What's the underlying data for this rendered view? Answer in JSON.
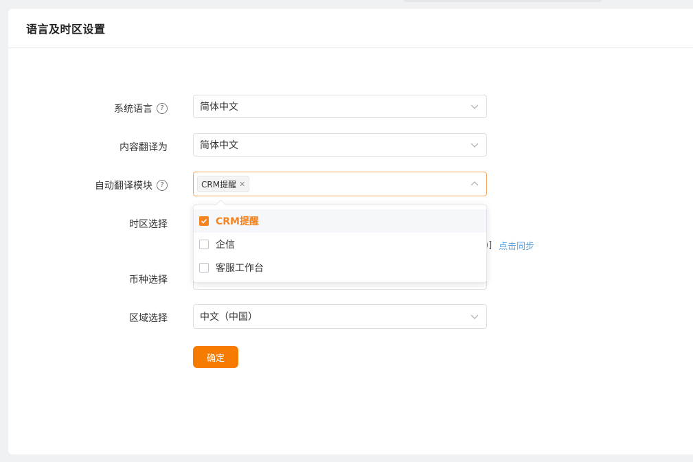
{
  "page": {
    "title": "语言及时区设置"
  },
  "form": {
    "system_language": {
      "label": "系统语言",
      "value": "简体中文"
    },
    "content_translate": {
      "label": "内容翻译为",
      "value": "简体中文"
    },
    "auto_translate_modules": {
      "label": "自动翻译模块",
      "selected_tags": [
        "CRM提醒"
      ],
      "options": [
        {
          "label": "CRM提醒",
          "checked": true
        },
        {
          "label": "企信",
          "checked": false
        },
        {
          "label": "客服工作台",
          "checked": false
        }
      ]
    },
    "timezone": {
      "label": "时区选择",
      "bracket_tail": ")]",
      "sync_link": "点击同步"
    },
    "currency": {
      "label": "币种选择"
    },
    "region": {
      "label": "区域选择",
      "value": "中文（中国）"
    },
    "confirm_label": "确定"
  },
  "icons": {
    "help": "question-circle-icon",
    "chevron_down": "chevron-down-icon",
    "chevron_up": "chevron-up-icon",
    "check": "check-icon",
    "tag_close": "close-icon"
  },
  "colors": {
    "accent": "#f57c00",
    "link": "#5aa3e0",
    "focus_border": "#f5a65b"
  }
}
